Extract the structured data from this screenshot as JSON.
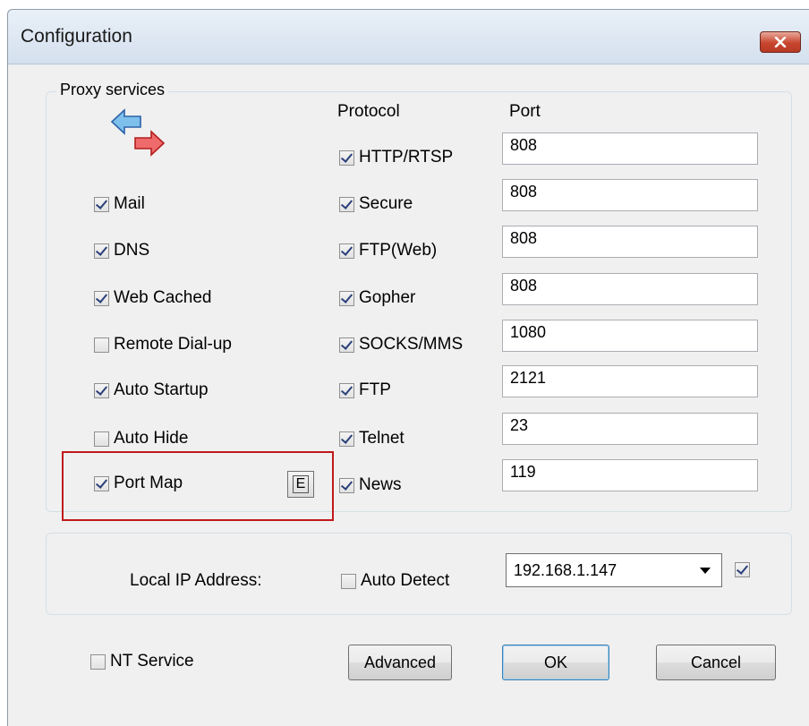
{
  "window": {
    "title": "Configuration"
  },
  "proxy_services": {
    "group_label": "Proxy services",
    "protocol_header": "Protocol",
    "port_header": "Port",
    "services": [
      {
        "label": "Mail",
        "checked": true
      },
      {
        "label": "DNS",
        "checked": true
      },
      {
        "label": "Web Cached",
        "checked": true
      },
      {
        "label": "Remote Dial-up",
        "checked": false
      },
      {
        "label": "Auto Startup",
        "checked": true
      },
      {
        "label": "Auto Hide",
        "checked": false
      },
      {
        "label": "Port Map",
        "checked": true
      }
    ],
    "port_map_edit_label": "E",
    "protocols": [
      {
        "label": "HTTP/RTSP",
        "checked": true,
        "port": "808"
      },
      {
        "label": "Secure",
        "checked": true,
        "port": "808"
      },
      {
        "label": "FTP(Web)",
        "checked": true,
        "port": "808"
      },
      {
        "label": "Gopher",
        "checked": true,
        "port": "808"
      },
      {
        "label": "SOCKS/MMS",
        "checked": true,
        "port": "1080"
      },
      {
        "label": "FTP",
        "checked": true,
        "port": "2121"
      },
      {
        "label": "Telnet",
        "checked": true,
        "port": "23"
      },
      {
        "label": "News",
        "checked": true,
        "port": "119"
      }
    ]
  },
  "network": {
    "local_ip_label": "Local IP Address:",
    "auto_detect_label": "Auto Detect",
    "auto_detect_checked": false,
    "ip_selected": "192.168.1.147",
    "ip_checkbox_checked": true
  },
  "footer": {
    "nt_service_label": "NT Service",
    "nt_service_checked": false,
    "advanced_label": "Advanced",
    "ok_label": "OK",
    "cancel_label": "Cancel"
  },
  "colors": {
    "highlight": "#c0191b",
    "titlebar": "#d4e0ee",
    "close": "#c8452f"
  },
  "icons": {
    "proxy_icon": "bidirectional-arrows-icon",
    "close_icon": "close-icon"
  }
}
